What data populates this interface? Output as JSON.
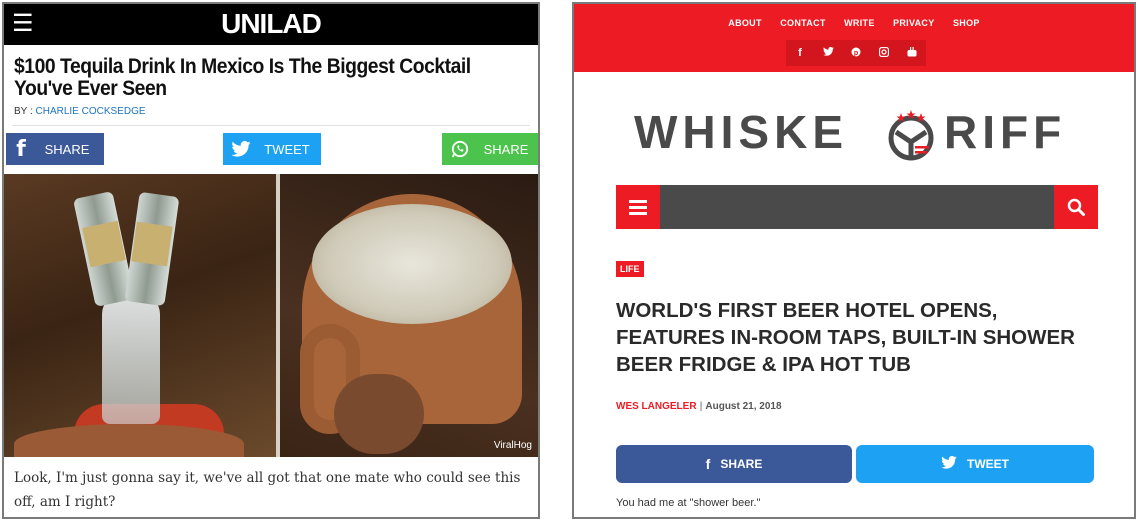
{
  "left": {
    "site_logo": "UNILAD",
    "title": "$100 Tequila Drink In Mexico Is The Biggest Cocktail You've Ever Seen",
    "byline_prefix": "BY : ",
    "author": "CHARLIE COCKSEDGE",
    "share_buttons": {
      "facebook": "SHARE",
      "twitter": "TWEET",
      "whatsapp": "SHARE"
    },
    "video_credit": "ViralHog",
    "body": "Look, I'm just gonna say it, we've all got that one mate who could see this off, am I right?"
  },
  "right": {
    "nav": [
      "ABOUT",
      "CONTACT",
      "WRITE",
      "PRIVACY",
      "SHOP"
    ],
    "social_icons": [
      "facebook-icon",
      "twitter-icon",
      "pinterest-icon",
      "instagram-icon",
      "youtube-icon"
    ],
    "logo_left": "WHISKE",
    "logo_right": "RIFF",
    "category": "LIFE",
    "headline": "WORLD'S FIRST BEER HOTEL OPENS, FEATURES IN-ROOM TAPS, BUILT-IN SHOWER BEER FRIDGE & IPA HOT TUB",
    "author": "WES LANGELER",
    "date": "August 21, 2018",
    "share_label": "SHARE",
    "tweet_label": "TWEET",
    "body": "You had me at \"shower beer.\""
  },
  "colors": {
    "unilad_bar": "#000000",
    "facebook": "#3b5998",
    "twitter": "#1da1f2",
    "whatsapp": "#4cc34c",
    "whiskey_red": "#ed1c24",
    "search_bar": "#4a4a4a"
  }
}
